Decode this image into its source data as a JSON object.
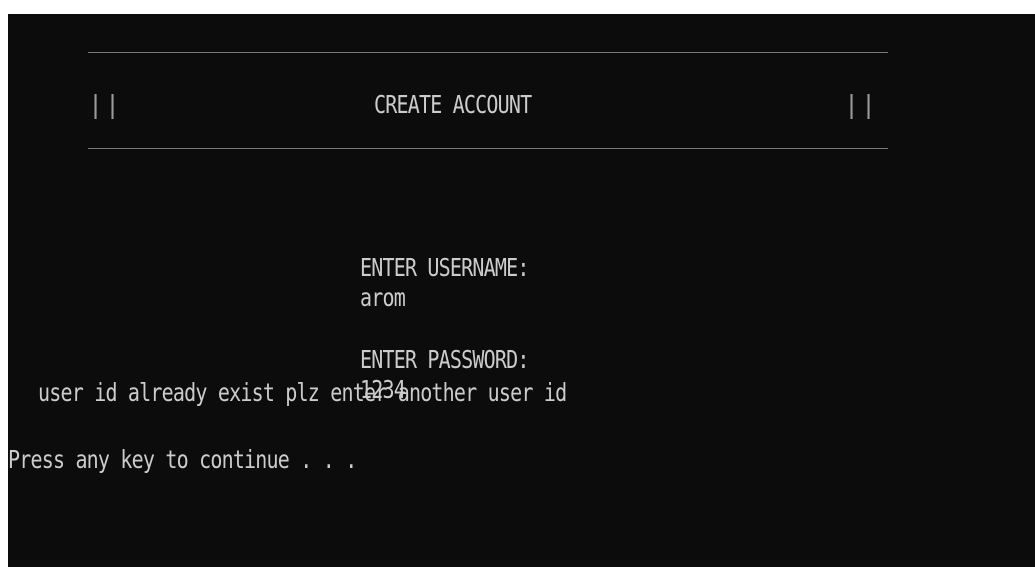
{
  "header": {
    "title": "CREATE ACCOUNT",
    "left_bars": "||",
    "right_bars": "||"
  },
  "form": {
    "username_label": "ENTER USERNAME:",
    "username_value": "arom",
    "password_label": "ENTER PASSWORD:",
    "password_value": "1234"
  },
  "messages": {
    "error": "user id already exist plz enter another user id",
    "prompt": "Press any key to continue . . ."
  },
  "colors": {
    "background": "#0c0c0c",
    "text": "#cccccc"
  }
}
